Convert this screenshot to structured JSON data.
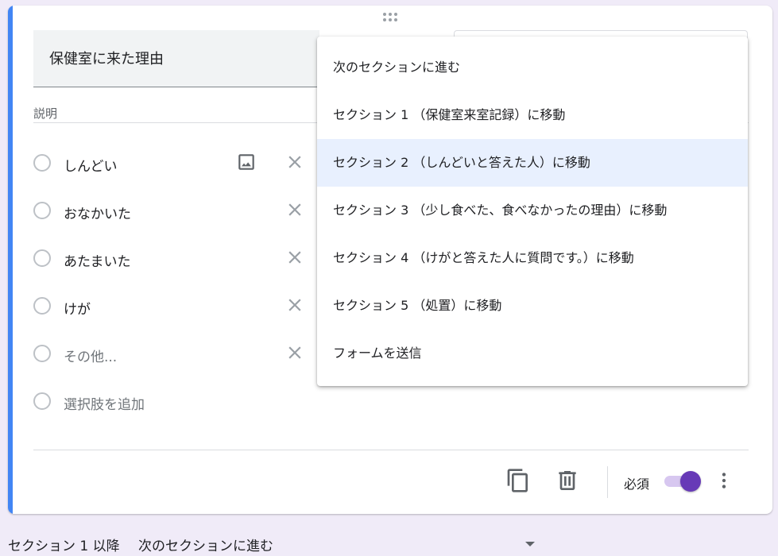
{
  "question": {
    "title": "保健室に来た理由",
    "description_placeholder": "説明",
    "options": [
      {
        "label": "しんどい",
        "muted": false
      },
      {
        "label": "おなかいた",
        "muted": false
      },
      {
        "label": "あたまいた",
        "muted": false
      },
      {
        "label": "けが",
        "muted": false
      },
      {
        "label": "その他...",
        "muted": true
      }
    ],
    "add_option": "選択肢を追加"
  },
  "toolbar": {
    "required_label": "必須",
    "required_on": true
  },
  "footer": {
    "after_section_label": "セクション 1 以降",
    "after_section_value": "次のセクションに進む"
  },
  "dropdown": {
    "items": [
      "次のセクションに進む",
      "セクション 1 （保健室来室記録）に移動",
      "セクション 2 （しんどいと答えた人）に移動",
      "セクション 3 （少し食べた、食べなかったの理由）に移動",
      "セクション 4 （けがと答えた人に質問です。）に移動",
      "セクション 5 （処置）に移動",
      "フォームを送信"
    ],
    "selected_index": 2
  },
  "colors": {
    "accent": "#4285f4",
    "toggle_on": "#673ab7",
    "page_bg": "#f0ebf8",
    "selected_bg": "#e8f0fe"
  }
}
